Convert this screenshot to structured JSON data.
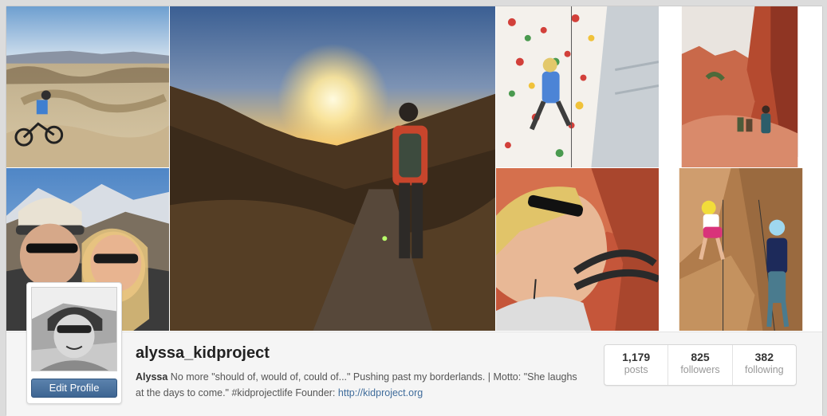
{
  "profile": {
    "username": "alyssa_kidproject",
    "display_name": "Alyssa",
    "bio_text": "No more \"should of, would of, could of...\" Pushing past my borderlands. | Motto: \"She laughs at the days to come.\" #kidprojectlife Founder:",
    "website": "http://kidproject.org",
    "edit_label": "Edit Profile"
  },
  "stats": [
    {
      "value": "1,179",
      "label": "posts"
    },
    {
      "value": "825",
      "label": "followers"
    },
    {
      "value": "382",
      "label": "following"
    }
  ],
  "colors": {
    "accent": "#3e6592",
    "link": "#3f6c9b"
  }
}
